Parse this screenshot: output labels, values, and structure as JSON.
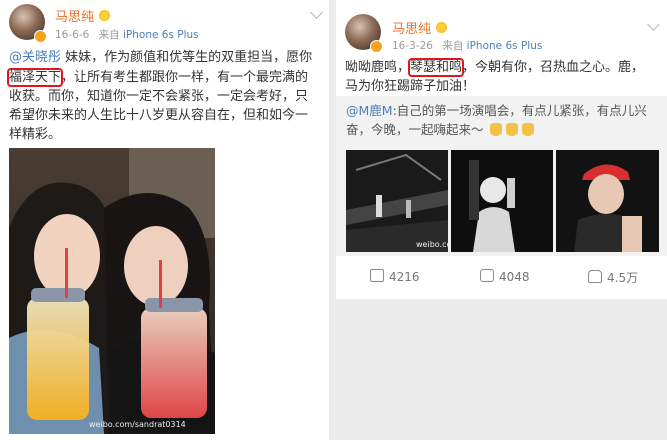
{
  "left_post": {
    "author": "马思纯",
    "date": "16-6-6",
    "source_prefix": "来自",
    "device": "iPhone 6s Plus",
    "mention": "@关晓彤",
    "line1_rest": " 妹妹，作为颜值和优等生的双重担当，愿你",
    "highlight": "福泽天下",
    "line2_rest": "，让所有考生都跟你一样，有一个最完满的",
    "line3": "收获。而你，知道你一定不会紧张，一定会考好，只",
    "line4": "希望你未来的人生比十八岁更从容自在，但和如今一",
    "line5": "样精彩。",
    "photo_watermark": "weibo.com/sandrat0314"
  },
  "right_post": {
    "author": "马思纯",
    "date": "16-3-26",
    "source_prefix": "来自",
    "device": "iPhone 6s Plus",
    "text_before": "呦呦鹿鸣，",
    "highlight": "琴瑟和鸣",
    "text_after": "，今朝有你，召热血之心。鹿，",
    "line2": "马为你狂踢蹄子加油！",
    "retweet": {
      "mention": "@M鹿M",
      "text_part1": ":自己的第一场演唱会，有点儿紧张，有点儿兴",
      "text_part2": "奋，今晚，一起嗨起来～",
      "photo_watermark": "weibo.com/luhan"
    },
    "actions": {
      "reposts": "4216",
      "comments": "4048",
      "likes": "4.5万"
    }
  },
  "colors": {
    "name": "#e8722a",
    "link": "#4a7fb8",
    "highlight_box": "#e3141b"
  }
}
